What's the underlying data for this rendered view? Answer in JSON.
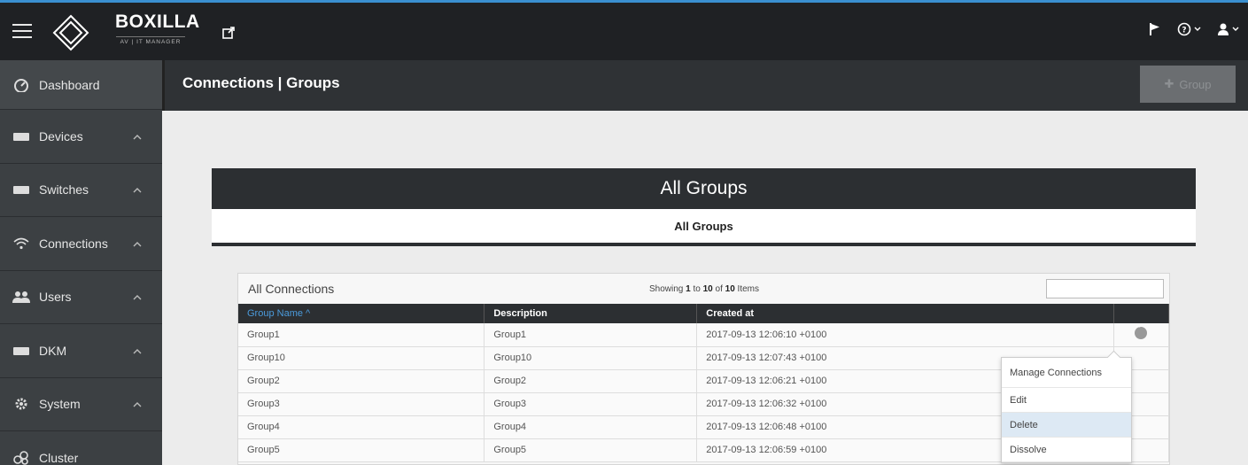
{
  "brand": {
    "name": "BOXILLA",
    "tagline": "AV | IT MANAGER"
  },
  "header": {
    "title": "Connections | Groups",
    "add_button": "Group"
  },
  "sidebar": {
    "items": [
      {
        "label": "Dashboard",
        "icon": "dashboard-icon",
        "has_chevron": false
      },
      {
        "label": "Devices",
        "icon": "device-icon",
        "has_chevron": true
      },
      {
        "label": "Switches",
        "icon": "switch-icon",
        "has_chevron": true
      },
      {
        "label": "Connections",
        "icon": "wifi-icon",
        "has_chevron": true
      },
      {
        "label": "Users",
        "icon": "users-icon",
        "has_chevron": true
      },
      {
        "label": "DKM",
        "icon": "dkm-icon",
        "has_chevron": true
      },
      {
        "label": "System",
        "icon": "gear-icon",
        "has_chevron": true
      },
      {
        "label": "Cluster",
        "icon": "cluster-icon",
        "has_chevron": false
      }
    ]
  },
  "panel": {
    "title": "All Groups",
    "subtitle": "All Groups"
  },
  "table_box": {
    "title": "All Connections",
    "showing_prefix": "Showing ",
    "showing_from": "1",
    "showing_to_word": " to ",
    "showing_to": "10",
    "showing_of_word": " of ",
    "showing_total": "10",
    "showing_suffix": " Items",
    "columns": [
      "Group Name ^",
      "Description",
      "Created at",
      ""
    ],
    "rows": [
      {
        "name": "Group1",
        "description": "Group1",
        "created": "2017-09-13 12:06:10 +0100"
      },
      {
        "name": "Group10",
        "description": "Group10",
        "created": "2017-09-13 12:07:43 +0100"
      },
      {
        "name": "Group2",
        "description": "Group2",
        "created": "2017-09-13 12:06:21 +0100"
      },
      {
        "name": "Group3",
        "description": "Group3",
        "created": "2017-09-13 12:06:32 +0100"
      },
      {
        "name": "Group4",
        "description": "Group4",
        "created": "2017-09-13 12:06:48 +0100"
      },
      {
        "name": "Group5",
        "description": "Group5",
        "created": "2017-09-13 12:06:59 +0100"
      }
    ]
  },
  "context_menu": {
    "items": [
      "Manage Connections",
      "Edit",
      "Delete",
      "Dissolve"
    ],
    "highlighted": "Delete"
  },
  "colors": {
    "accent": "#3a8fd0",
    "sort_link": "#4b9bdc",
    "sidebar_bg": "#3c4043",
    "topbar_bg": "#1f2124"
  }
}
